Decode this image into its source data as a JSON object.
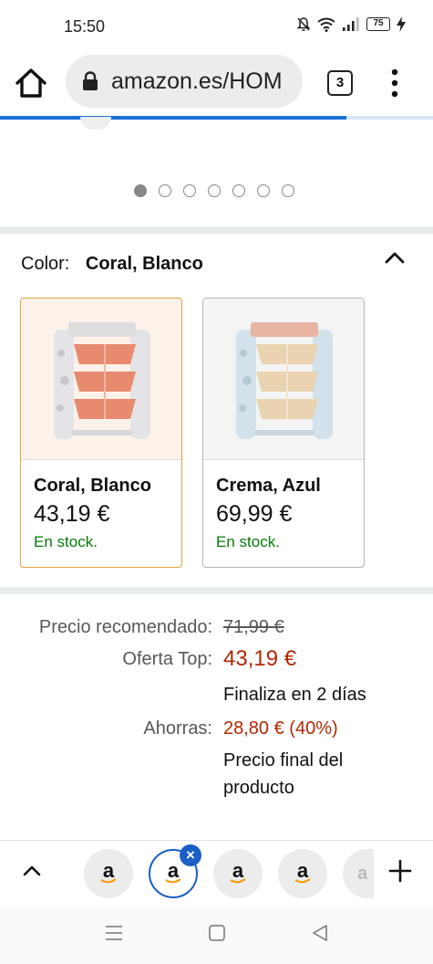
{
  "status_bar": {
    "time": "15:50",
    "battery": "75",
    "icons": [
      "mute-icon",
      "wifi-icon",
      "signal-icon",
      "battery-icon",
      "charging-icon"
    ]
  },
  "browser": {
    "url": "amazon.es/HOM",
    "tab_count": "3",
    "icons": [
      "home-icon",
      "lock-icon",
      "tabs-icon",
      "menu-icon"
    ],
    "accent": "#1a6fd6"
  },
  "carousel": {
    "dot_count": 7,
    "active_index": 0
  },
  "color_selector": {
    "label": "Color:",
    "selected": "Coral, Blanco",
    "options": [
      {
        "name": "Coral, Blanco",
        "price": "43,19 €",
        "stock": "En stock.",
        "selected": true
      },
      {
        "name": "Crema, Azul",
        "price": "69,99 €",
        "stock": "En stock.",
        "selected": false
      }
    ]
  },
  "pricing": {
    "list_price_label": "Precio recomendado:",
    "list_price": "71,99 €",
    "deal_label": "Oferta Top:",
    "deal_price": "43,19 €",
    "deal_ends": "Finaliza en 2 días",
    "savings_label": "Ahorras:",
    "savings": "28,80 € (40%)",
    "final_price_note_line1": "Precio final del",
    "final_price_note_line2": "producto",
    "colors": {
      "deal": "#b12704",
      "stock": "#0a7a0a",
      "selected_border": "#e3a23d"
    }
  },
  "tab_strip": {
    "tabs": [
      {
        "letter": "a",
        "active": false
      },
      {
        "letter": "a",
        "active": true
      },
      {
        "letter": "a",
        "active": false
      },
      {
        "letter": "a",
        "active": false
      },
      {
        "letter": "a",
        "active": false
      }
    ],
    "close_glyph": "×",
    "icons": [
      "chevron-up-icon",
      "plus-icon"
    ]
  },
  "nav_bar": {
    "icons": [
      "recents-icon",
      "home-square-icon",
      "back-icon"
    ]
  }
}
